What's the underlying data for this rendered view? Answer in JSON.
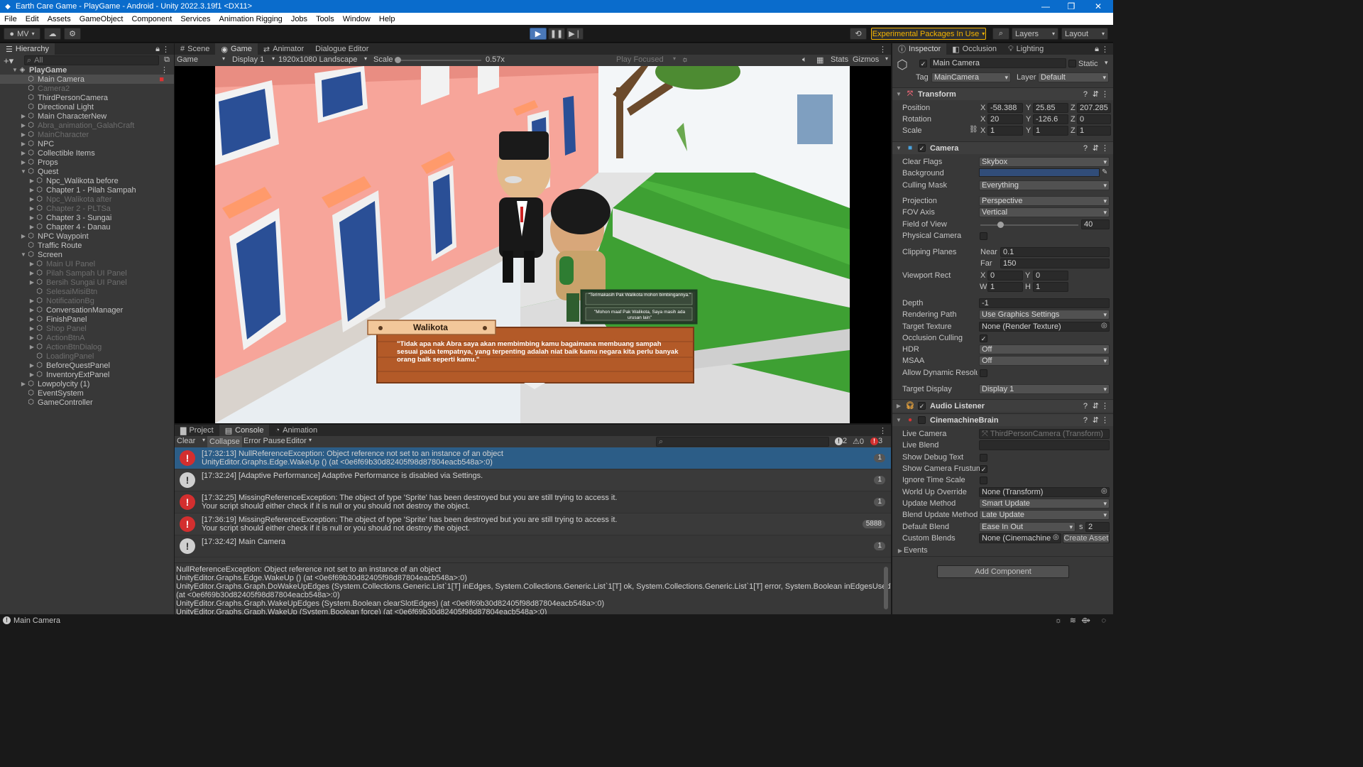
{
  "window": {
    "title": "Earth Care Game - PlayGame - Android - Unity 2022.3.19f1 <DX11>"
  },
  "menu": [
    "File",
    "Edit",
    "Assets",
    "GameObject",
    "Component",
    "Services",
    "Animation Rigging",
    "Jobs",
    "Tools",
    "Window",
    "Help"
  ],
  "toolbar": {
    "account": "MV",
    "experimental": "Experimental Packages In Use",
    "layers": "Layers",
    "layout": "Layout"
  },
  "hierarchy": {
    "title": "Hierarchy",
    "search_placeholder": "All",
    "items": [
      {
        "label": "PlayGame",
        "depth": 0,
        "exp": "open",
        "state": "scene"
      },
      {
        "label": "Main Camera",
        "depth": 1,
        "exp": "",
        "state": "selected"
      },
      {
        "label": "Camera2",
        "depth": 1,
        "exp": "",
        "state": "disabled"
      },
      {
        "label": "ThirdPersonCamera",
        "depth": 1,
        "exp": "",
        "state": ""
      },
      {
        "label": "Directional Light",
        "depth": 1,
        "exp": "",
        "state": ""
      },
      {
        "label": "Main CharacterNew",
        "depth": 1,
        "exp": "closed",
        "state": ""
      },
      {
        "label": "Abra_animation_GalahCraft",
        "depth": 1,
        "exp": "closed",
        "state": "disabled"
      },
      {
        "label": "MainCharacter",
        "depth": 1,
        "exp": "closed",
        "state": "disabled"
      },
      {
        "label": "NPC",
        "depth": 1,
        "exp": "closed",
        "state": ""
      },
      {
        "label": "Collectible Items",
        "depth": 1,
        "exp": "closed",
        "state": ""
      },
      {
        "label": "Props",
        "depth": 1,
        "exp": "closed",
        "state": ""
      },
      {
        "label": "Quest",
        "depth": 1,
        "exp": "open",
        "state": ""
      },
      {
        "label": "Npc_Walikota before",
        "depth": 2,
        "exp": "closed",
        "state": ""
      },
      {
        "label": "Chapter 1 - Pilah Sampah",
        "depth": 2,
        "exp": "closed",
        "state": ""
      },
      {
        "label": "Npc_Walikota after",
        "depth": 2,
        "exp": "closed",
        "state": "disabled"
      },
      {
        "label": "Chapter 2 - PLTSa",
        "depth": 2,
        "exp": "closed",
        "state": "disabled"
      },
      {
        "label": "Chapter 3 - Sungai",
        "depth": 2,
        "exp": "closed",
        "state": ""
      },
      {
        "label": "Chapter 4 - Danau",
        "depth": 2,
        "exp": "closed",
        "state": ""
      },
      {
        "label": "NPC Waypoint",
        "depth": 1,
        "exp": "closed",
        "state": ""
      },
      {
        "label": "Traffic Route",
        "depth": 1,
        "exp": "",
        "state": ""
      },
      {
        "label": "Screen",
        "depth": 1,
        "exp": "open",
        "state": ""
      },
      {
        "label": "Main UI Panel",
        "depth": 2,
        "exp": "closed",
        "state": "disabled"
      },
      {
        "label": "Pilah Sampah UI Panel",
        "depth": 2,
        "exp": "closed",
        "state": "disabled"
      },
      {
        "label": "Bersih Sungai UI Panel",
        "depth": 2,
        "exp": "closed",
        "state": "disabled"
      },
      {
        "label": "SelesaiMisiBtn",
        "depth": 2,
        "exp": "",
        "state": "disabled"
      },
      {
        "label": "NotificationBg",
        "depth": 2,
        "exp": "closed",
        "state": "disabled"
      },
      {
        "label": "ConversationManager",
        "depth": 2,
        "exp": "closed",
        "state": ""
      },
      {
        "label": "FinishPanel",
        "depth": 2,
        "exp": "closed",
        "state": ""
      },
      {
        "label": "Shop Panel",
        "depth": 2,
        "exp": "closed",
        "state": "disabled"
      },
      {
        "label": "ActionBtnA",
        "depth": 2,
        "exp": "closed",
        "state": "disabled"
      },
      {
        "label": "ActionBtnDialog",
        "depth": 2,
        "exp": "closed",
        "state": "disabled"
      },
      {
        "label": "LoadingPanel",
        "depth": 2,
        "exp": "",
        "state": "disabled"
      },
      {
        "label": "BeforeQuestPanel",
        "depth": 2,
        "exp": "closed",
        "state": ""
      },
      {
        "label": "InventoryExtPanel",
        "depth": 2,
        "exp": "closed",
        "state": ""
      },
      {
        "label": "Lowpolycity (1)",
        "depth": 1,
        "exp": "closed",
        "state": ""
      },
      {
        "label": "EventSystem",
        "depth": 1,
        "exp": "",
        "state": ""
      },
      {
        "label": "GameController",
        "depth": 1,
        "exp": "",
        "state": ""
      }
    ]
  },
  "game_view": {
    "tabs": [
      "Scene",
      "Game",
      "Animator",
      "Dialogue Editor"
    ],
    "active_tab": "Game",
    "mode": "Game",
    "display": "Display 1",
    "resolution": "1920x1080 Landscape",
    "scale_label": "Scale",
    "scale_value": "0.57x",
    "play_focused": "Play Focused",
    "stats": "Stats",
    "gizmos": "Gizmos",
    "dialogue": {
      "speaker": "Walikota",
      "text": "\"Tidak apa nak Abra saya akan membimbing kamu bagaimana membuang sampah sesuai pada tempatnya, yang terpenting adalah niat baik kamu negara kita perlu banyak orang baik seperti kamu.\"",
      "choices": [
        "\"Terimakasih Pak Walikota mohon bimbingannya.\"",
        "\"Mohon maaf Pak Walikota, Saya masih ada urusan lain\""
      ]
    }
  },
  "console": {
    "tabs": [
      "Project",
      "Console",
      "Animation"
    ],
    "active_tab": "Console",
    "buttons": {
      "clear": "Clear",
      "collapse": "Collapse",
      "error_pause": "Error Pause",
      "editor": "Editor"
    },
    "counts": {
      "info": "2",
      "warn": "0",
      "error": "3"
    },
    "logs": [
      {
        "type": "error",
        "line1": "[17:32:13] NullReferenceException: Object reference not set to an instance of an object",
        "line2": "UnityEditor.Graphs.Edge.WakeUp () (at <0e6f69b30d82405f98d87804eacb548a>:0)",
        "count": "1",
        "selected": true
      },
      {
        "type": "info",
        "line1": "[17:32:24] [Adaptive Performance] Adaptive Performance is disabled via Settings.",
        "line2": "",
        "count": "1",
        "selected": false
      },
      {
        "type": "error",
        "line1": "[17:32:25] MissingReferenceException: The object of type 'Sprite' has been destroyed but you are still trying to access it.",
        "line2": "Your script should either check if it is null or you should not destroy the object.",
        "count": "1",
        "selected": false
      },
      {
        "type": "error",
        "line1": "[17:36:19] MissingReferenceException: The object of type 'Sprite' has been destroyed but you are still trying to access it.",
        "line2": "Your script should either check if it is null or you should not destroy the object.",
        "count": "5888",
        "selected": false
      },
      {
        "type": "info",
        "line1": "[17:32:42] Main Camera",
        "line2": "",
        "count": "1",
        "selected": false
      }
    ],
    "detail": [
      "NullReferenceException: Object reference not set to an instance of an object",
      "UnityEditor.Graphs.Edge.WakeUp () (at <0e6f69b30d82405f98d87804eacb548a>:0)",
      "UnityEditor.Graphs.Graph.DoWakeUpEdges (System.Collections.Generic.List`1[T] inEdges, System.Collections.Generic.List`1[T] ok, System.Collections.Generic.List`1[T] error, System.Boolean inEdgesUsedToBeValid)",
      "(at <0e6f69b30d82405f98d87804eacb548a>:0)",
      "UnityEditor.Graphs.Graph.WakeUpEdges (System.Boolean clearSlotEdges) (at <0e6f69b30d82405f98d87804eacb548a>:0)",
      "UnityEditor.Graphs.Graph.WakeUp (System.Boolean force) (at <0e6f69b30d82405f98d87804eacb548a>:0)"
    ]
  },
  "inspector": {
    "tabs": [
      "Inspector",
      "Occlusion",
      "Lighting"
    ],
    "object_name": "Main Camera",
    "static_label": "Static",
    "tag_label": "Tag",
    "tag": "MainCamera",
    "layer_label": "Layer",
    "layer": "Default",
    "transform": {
      "title": "Transform",
      "position_label": "Position",
      "rotation_label": "Rotation",
      "scale_label": "Scale",
      "px": "-58.388",
      "py": "25.85",
      "pz": "207.285",
      "rx": "20",
      "ry": "-126.6",
      "rz": "0",
      "sx": "1",
      "sy": "1",
      "sz": "1"
    },
    "camera": {
      "title": "Camera",
      "clear_flags_label": "Clear Flags",
      "clear_flags": "Skybox",
      "background_label": "Background",
      "background_color": "#314d79",
      "culling_mask_label": "Culling Mask",
      "culling_mask": "Everything",
      "projection_label": "Projection",
      "projection": "Perspective",
      "fov_axis_label": "FOV Axis",
      "fov_axis": "Vertical",
      "fov_label": "Field of View",
      "fov": "40",
      "fov_fraction": 0.2,
      "physical_label": "Physical Camera",
      "clipping_label": "Clipping Planes",
      "near_label": "Near",
      "near": "0.1",
      "far_label": "Far",
      "far": "150",
      "viewport_label": "Viewport Rect",
      "vx": "0",
      "vy": "0",
      "vw": "1",
      "vh": "1",
      "depth_label": "Depth",
      "depth": "-1",
      "rendering_path_label": "Rendering Path",
      "rendering_path": "Use Graphics Settings",
      "target_texture_label": "Target Texture",
      "target_texture": "None (Render Texture)",
      "occlusion_label": "Occlusion Culling",
      "hdr_label": "HDR",
      "hdr": "Off",
      "msaa_label": "MSAA",
      "msaa": "Off",
      "dyn_res_label": "Allow Dynamic Resolut",
      "target_display_label": "Target Display",
      "target_display": "Display 1"
    },
    "audio_listener": {
      "title": "Audio Listener"
    },
    "cinemachine": {
      "title": "CinemachineBrain",
      "live_camera_label": "Live Camera",
      "live_camera": "ThirdPersonCamera (Transform)",
      "live_blend_label": "Live Blend",
      "show_debug_label": "Show Debug Text",
      "show_frustum_label": "Show Camera Frustum",
      "ignore_time_label": "Ignore Time Scale",
      "world_up_label": "World Up Override",
      "world_up": "None (Transform)",
      "update_method_label": "Update Method",
      "update_method": "Smart Update",
      "blend_update_label": "Blend Update Method",
      "blend_update": "Late Update",
      "default_blend_label": "Default Blend",
      "default_blend": "Ease In Out",
      "default_blend_s": "2",
      "custom_blends_label": "Custom Blends",
      "custom_blends": "None (Cinemachine",
      "create_asset": "Create Asset",
      "events_label": "Events"
    },
    "add_component": "Add Component"
  },
  "status": {
    "text": "Main Camera"
  }
}
